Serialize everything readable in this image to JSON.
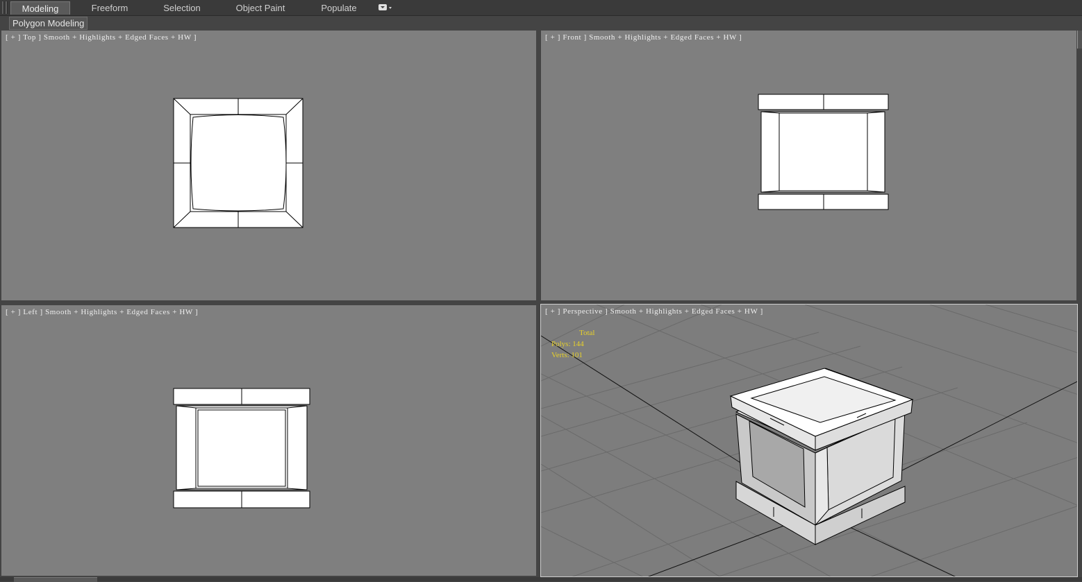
{
  "ribbon": {
    "tabs": [
      {
        "label": "Modeling",
        "active": true
      },
      {
        "label": "Freeform",
        "active": false
      },
      {
        "label": "Selection",
        "active": false
      },
      {
        "label": "Object Paint",
        "active": false
      },
      {
        "label": "Populate",
        "active": false
      }
    ],
    "dropdown_icon": "ribbon-options-icon",
    "panel_label": "Polygon Modeling"
  },
  "viewports": {
    "top": {
      "label": "[ + ] Top ] Smooth + Highlights + Edged Faces + HW ]"
    },
    "front": {
      "label": "[ + ] Front ] Smooth + Highlights + Edged Faces + HW ]"
    },
    "left": {
      "label": "[ + ] Left ] Smooth + Highlights + Edged Faces + HW ]"
    },
    "perspective": {
      "label": "[ + ] Perspective ] Smooth + Highlights + Edged Faces + HW ]",
      "stats": {
        "header": "Total",
        "polys": "Polys: 144",
        "verts": "Verts: 101"
      }
    }
  },
  "colors": {
    "viewport_bg": "#7f7f7f",
    "stats_text": "#e8d12a",
    "mesh_fill": "#ffffff",
    "mesh_edge": "#000000"
  }
}
